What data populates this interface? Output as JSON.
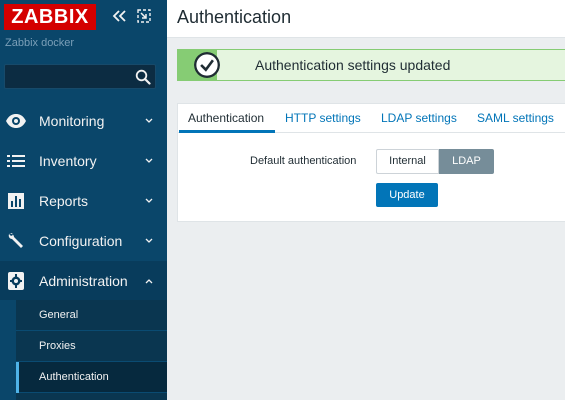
{
  "app": {
    "logo_text": "ZABBIX",
    "server_name": "Zabbix docker"
  },
  "search": {
    "value": "",
    "placeholder": ""
  },
  "sidebar": {
    "items": [
      {
        "label": "Monitoring",
        "icon": "eye-icon"
      },
      {
        "label": "Inventory",
        "icon": "list-icon"
      },
      {
        "label": "Reports",
        "icon": "bar-chart-icon"
      },
      {
        "label": "Configuration",
        "icon": "wrench-icon"
      },
      {
        "label": "Administration",
        "icon": "gear-icon",
        "expanded": true
      }
    ],
    "submenu": [
      {
        "label": "General"
      },
      {
        "label": "Proxies"
      },
      {
        "label": "Authentication",
        "active": true
      }
    ]
  },
  "header": {
    "title": "Authentication"
  },
  "message": {
    "text": "Authentication settings updated",
    "type": "success"
  },
  "tabs": [
    {
      "label": "Authentication",
      "active": true
    },
    {
      "label": "HTTP settings"
    },
    {
      "label": "LDAP settings"
    },
    {
      "label": "SAML settings"
    }
  ],
  "form": {
    "default_auth_label": "Default authentication",
    "options": [
      "Internal",
      "LDAP"
    ],
    "selected": "LDAP",
    "update_label": "Update"
  },
  "colors": {
    "sidebar": "#0a466a",
    "logo": "#d40000",
    "accent": "#0275b8",
    "success": "#86cc74",
    "selected_radio": "#768d99"
  }
}
